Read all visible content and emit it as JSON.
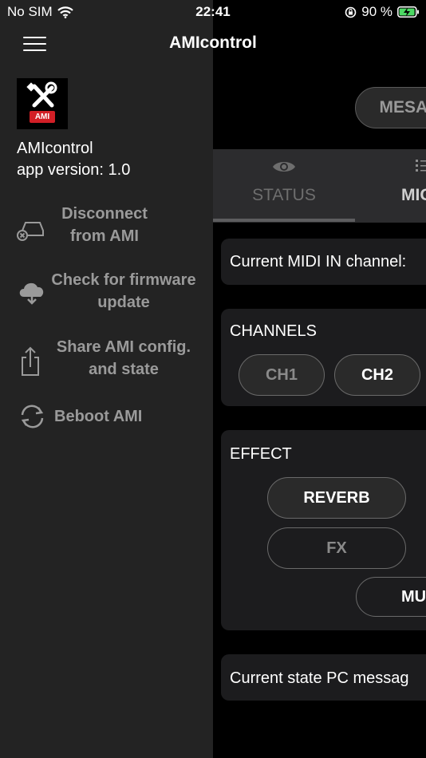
{
  "status_bar": {
    "carrier": "No SIM",
    "time": "22:41",
    "battery_percent": "90 %"
  },
  "nav": {
    "title": "AMIcontrol"
  },
  "drawer": {
    "logo_badge": "AMI",
    "app_name": "AMIcontrol",
    "app_version": "app version:  1.0",
    "items": [
      {
        "label": "Disconnect from AMI",
        "icon": "car-disconnect-icon"
      },
      {
        "label": "Check for firmware update",
        "icon": "cloud-download-icon"
      },
      {
        "label": "Share AMI config. and state",
        "icon": "share-icon"
      },
      {
        "label": "Beboot AMI",
        "icon": "reboot-icon"
      }
    ]
  },
  "main": {
    "device_button": "MESA B",
    "tabs": [
      {
        "label": "STATUS",
        "icon": "eye-icon"
      },
      {
        "label": "MIGI",
        "icon": "list-icon"
      }
    ],
    "midi_channel_text": "Current MIDI IN channel:",
    "channels_title": "CHANNELS",
    "channels": [
      "CH1",
      "CH2"
    ],
    "effect_title": "EFFECT",
    "effects": [
      "REVERB",
      "FX",
      "MU"
    ],
    "pc_message_text": "Current state PC messag"
  },
  "colors": {
    "drawer_bg": "#232323",
    "battery": "#4cd964",
    "muted_text": "#9a9a9a"
  }
}
